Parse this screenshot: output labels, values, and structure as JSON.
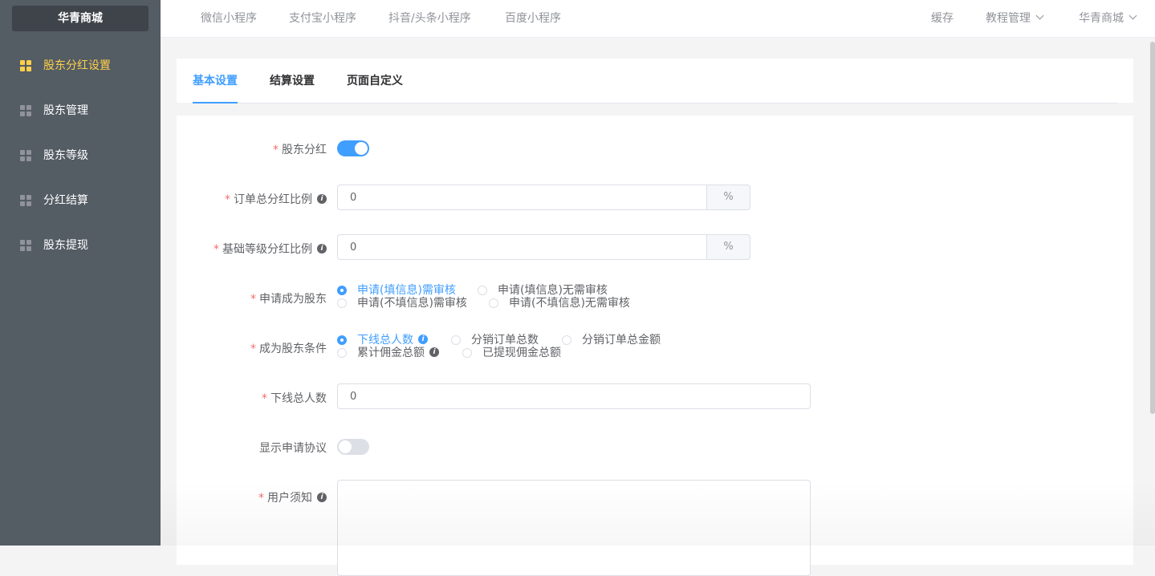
{
  "sidebar": {
    "brand": "华青商城",
    "items": [
      {
        "label": "股东分红设置",
        "active": true
      },
      {
        "label": "股东管理"
      },
      {
        "label": "股东等级"
      },
      {
        "label": "分红结算"
      },
      {
        "label": "股东提现"
      }
    ]
  },
  "header": {
    "nav": [
      "微信小程序",
      "支付宝小程序",
      "抖音/头条小程序",
      "百度小程序"
    ],
    "right": {
      "cache": "缓存",
      "tutorial": "教程管理",
      "store": "华青商城"
    }
  },
  "tabs": [
    "基本设置",
    "结算设置",
    "页面自定义"
  ],
  "form": {
    "dividend": {
      "label": "股东分红",
      "enabled": true
    },
    "order_ratio": {
      "label": "订单总分红比例",
      "value": "0",
      "suffix": "%"
    },
    "base_ratio": {
      "label": "基础等级分红比例",
      "value": "0",
      "suffix": "%"
    },
    "apply": {
      "label": "申请成为股东",
      "options": [
        "申请(填信息)需审核",
        "申请(填信息)无需审核",
        "申请(不填信息)需审核",
        "申请(不填信息)无需审核"
      ],
      "selected": "申请(填信息)需审核"
    },
    "condition": {
      "label": "成为股东条件",
      "options": [
        "下线总人数",
        "分销订单总数",
        "分销订单总金额",
        "累计佣金总额",
        "已提现佣金总额"
      ],
      "selected": "下线总人数"
    },
    "downline": {
      "label": "下线总人数",
      "value": "0"
    },
    "show_agreement": {
      "label": "显示申请协议",
      "enabled": false
    },
    "notice": {
      "label": "用户须知",
      "value": ""
    }
  },
  "colors": {
    "accent": "#409eff",
    "sidebar_bg": "#545c64",
    "active_menu": "#ffd04b",
    "required": "#f56c6c"
  },
  "icons": {
    "menu": "grid-icon",
    "info": "info-icon",
    "chevron": "chevron-down-icon"
  }
}
